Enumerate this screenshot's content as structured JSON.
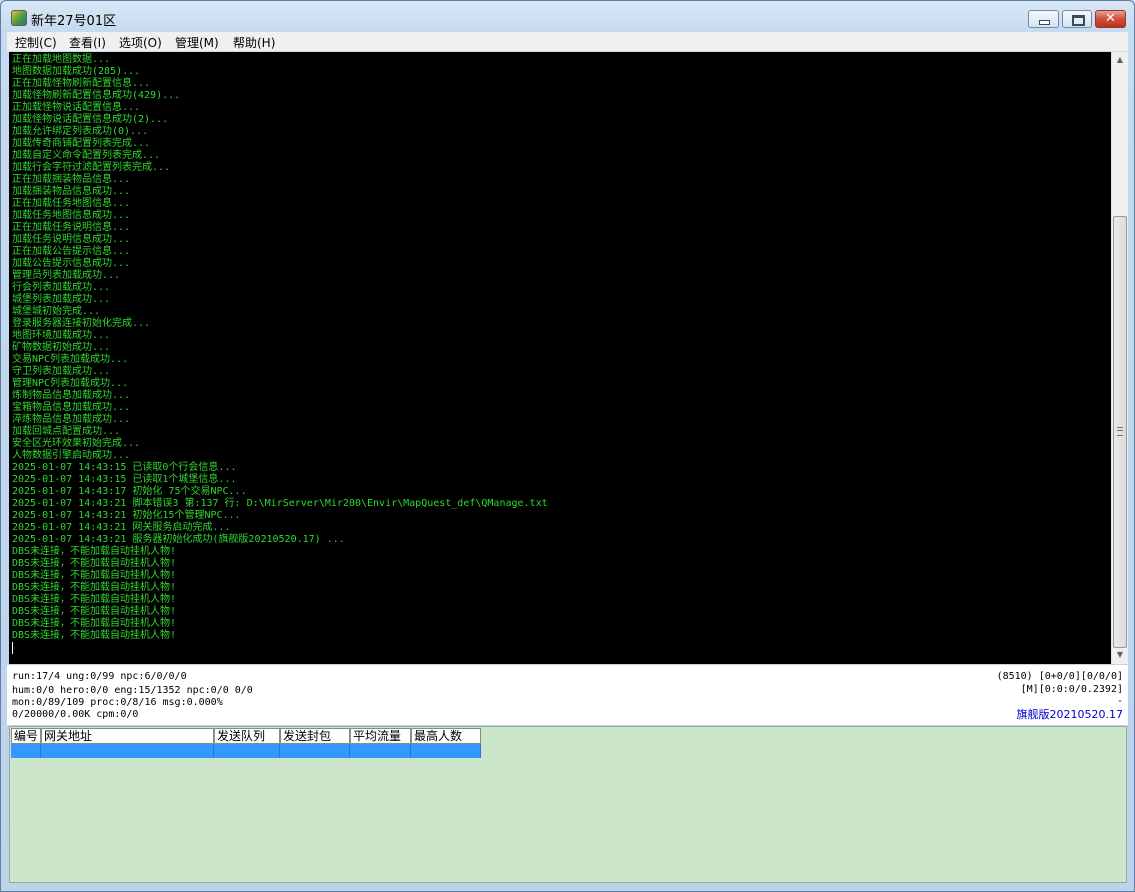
{
  "window": {
    "title": "新年27号01区"
  },
  "menu": [
    "控制(C)",
    "查看(I)",
    "选项(O)",
    "管理(M)",
    "帮助(H)"
  ],
  "console_lines": [
    "正在加载地图数据...",
    "地图数据加载成功(285)...",
    "正在加载怪物刷新配置信息...",
    "加载怪物刷新配置信息成功(429)...",
    "正加载怪物说话配置信息...",
    "加载怪物说话配置信息成功(2)...",
    "加载允许绑定列表成功(0)...",
    "加载传奇商铺配置列表完成...",
    "加载自定义命令配置列表完成...",
    "加载行会字符过滤配置列表完成...",
    "正在加载捆装物品信息...",
    "加载捆装物品信息成功...",
    "正在加载任务地图信息...",
    "加载任务地图信息成功...",
    "正在加载任务说明信息...",
    "加载任务说明信息成功...",
    "正在加载公告提示信息...",
    "加载公告提示信息成功...",
    "管理员列表加载成功...",
    "行会列表加载成功...",
    "城堡列表加载成功...",
    "城堡城初始完成...",
    "登录服务器连接初始化完成...",
    "地图环境加载成功...",
    "矿物数据初始成功...",
    "交易NPC列表加载成功...",
    "守卫列表加载成功...",
    "管理NPC列表加载成功...",
    "炼制物品信息加载成功...",
    "宝箱物品信息加载成功...",
    "淬炼物品信息加载成功...",
    "加载回城点配置成功...",
    "安全区光环效果初始完成...",
    "人物数据引擎启动成功...",
    "2025-01-07 14:43:15 已读取0个行会信息...",
    "2025-01-07 14:43:15 已读取1个城堡信息...",
    "2025-01-07 14:43:17 初始化 75个交易NPC...",
    "2025-01-07 14:43:21 脚本错误3 第:137 行: D:\\MirServer\\Mir200\\Envir\\MapQuest_def\\QManage.txt",
    "2025-01-07 14:43:21 初始化15个管理NPC...",
    "2025-01-07 14:43:21 网关服务启动完成...",
    "2025-01-07 14:43:21 服务器初始化成功(旗舰版20210520.17) ...",
    "DBS未连接，不能加载自动挂机人物!",
    "DBS未连接，不能加载自动挂机人物!",
    "DBS未连接，不能加载自动挂机人物!",
    "DBS未连接，不能加载自动挂机人物!",
    "DBS未连接，不能加载自动挂机人物!",
    "DBS未连接，不能加载自动挂机人物!",
    "DBS未连接，不能加载自动挂机人物!",
    "DBS未连接，不能加载自动挂机人物!"
  ],
  "status": {
    "line1": "run:17/4 ung:0/99 npc:6/0/0/0",
    "line2": "hum:0/0 hero:0/0 eng:15/1352 npc:0/0 0/0",
    "line3": "mon:0/89/109 proc:0/8/16 msg:0.000%",
    "line4": "0/20000/0.00K cpm:0/0",
    "right1": "(8510) [0+0/0][0/0/0]",
    "right2": "[M][0:0:0/0.2392]",
    "right3": "-",
    "version": "旗舰版20210520.17"
  },
  "gateway_columns": [
    "编号",
    "网关地址",
    "发送队列",
    "发送封包",
    "平均流量",
    "最高人数"
  ],
  "icons": {
    "minimize": "minimize-icon",
    "maximize": "maximize-icon",
    "close": "close-icon",
    "scroll_up": "scroll-up-arrow-icon",
    "scroll_down": "scroll-down-arrow-icon"
  },
  "colors": {
    "console_text": "#2fd82f",
    "console_bg": "#000000",
    "selection": "#3399ff",
    "panel_bg": "#cce6cc"
  }
}
